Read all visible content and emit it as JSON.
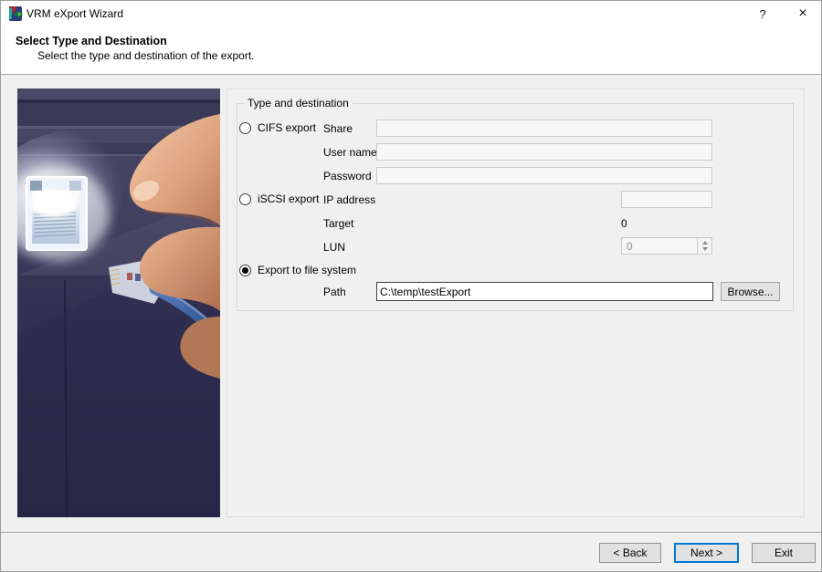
{
  "window": {
    "title": "VRM eXport Wizard",
    "help_glyph": "?",
    "close_glyph": "×"
  },
  "header": {
    "title": "Select Type and Destination",
    "subtitle": "Select the type and destination of the export."
  },
  "group": {
    "title": "Type and destination"
  },
  "options": {
    "cifs": {
      "label": "CIFS export",
      "selected": false
    },
    "iscsi": {
      "label": "iSCSI export",
      "selected": false
    },
    "file": {
      "label": "Export to file system",
      "selected": true
    }
  },
  "fields": {
    "share": {
      "label": "Share",
      "value": "",
      "disabled": true
    },
    "user_name": {
      "label": "User name",
      "value": "",
      "disabled": true
    },
    "password": {
      "label": "Password",
      "value": "",
      "disabled": true
    },
    "ip_address": {
      "label": "IP address",
      "value": "",
      "disabled": true
    },
    "target": {
      "label": "Target",
      "value": "0",
      "disabled": false
    },
    "lun": {
      "label": "LUN",
      "value": "0",
      "disabled": true
    },
    "path": {
      "label": "Path",
      "value": "C:\\temp\\testExport",
      "disabled": false
    }
  },
  "buttons": {
    "browse": "Browse...",
    "back": "< Back",
    "next": "Next >",
    "exit": "Exit"
  },
  "colors": {
    "accent": "#0078d7",
    "body_bg": "#f0f0f0",
    "header_bg": "#ffffff",
    "photo_dark": "#242340",
    "photo_skin": "#d99d7b",
    "cable_blue": "#35589a"
  }
}
